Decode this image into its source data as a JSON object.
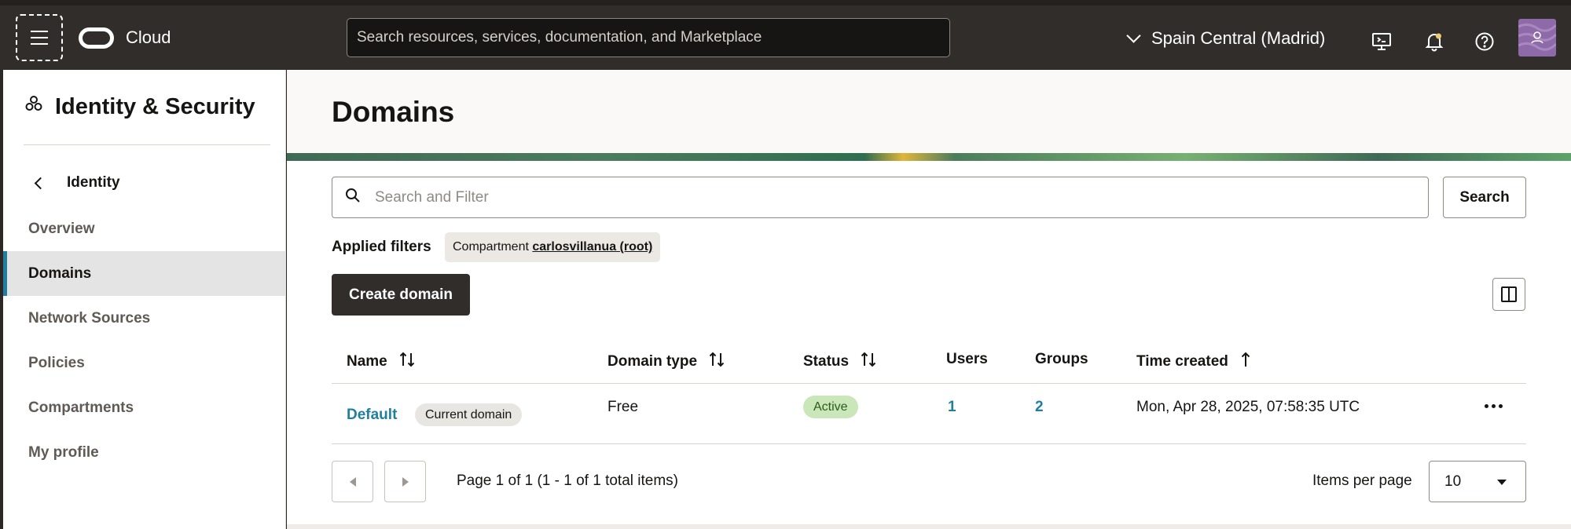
{
  "topbar": {
    "brand": "Cloud",
    "search_placeholder": "Search resources, services, documentation, and Marketplace",
    "region": "Spain Central (Madrid)"
  },
  "sidebar": {
    "title": "Identity & Security",
    "back_label": "Identity",
    "items": [
      {
        "label": "Overview"
      },
      {
        "label": "Domains",
        "active": true
      },
      {
        "label": "Network Sources"
      },
      {
        "label": "Policies"
      },
      {
        "label": "Compartments"
      },
      {
        "label": "My profile"
      }
    ]
  },
  "main": {
    "title": "Domains",
    "filter_placeholder": "Search and Filter",
    "search_button": "Search",
    "applied_filters_label": "Applied filters",
    "filter_chip": {
      "key": "Compartment",
      "value": "carlosvillanua (root)"
    },
    "create_button": "Create domain"
  },
  "table": {
    "columns": [
      "Name",
      "Domain type",
      "Status",
      "Users",
      "Groups",
      "Time created"
    ],
    "rows": [
      {
        "name": "Default",
        "badge": "Current domain",
        "domain_type": "Free",
        "status": "Active",
        "users": "1",
        "groups": "2",
        "time_created": "Mon, Apr 28, 2025, 07:58:35 UTC"
      }
    ]
  },
  "pagination": {
    "info": "Page 1 of 1 (1 - 1 of 1 total items)",
    "items_per_page_label": "Items per page",
    "items_per_page": "10"
  },
  "colors": {
    "topbar": "#312d2a",
    "link": "#227e9e",
    "active_badge": "#c9e7b9",
    "primary_button": "#312d2a"
  }
}
